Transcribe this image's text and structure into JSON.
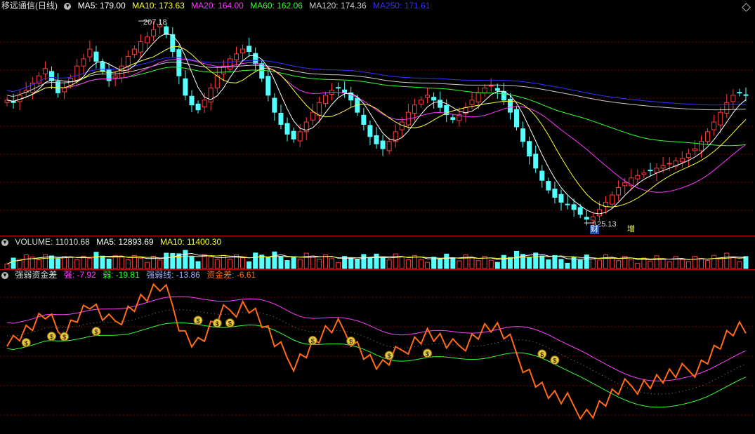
{
  "colors": {
    "up": "#ff3b3b",
    "down": "#54ffff",
    "ma5": "#ffffff",
    "ma10": "#ffff33",
    "ma20": "#ff33ff",
    "ma60": "#33ff33",
    "ma120": "#cccccc",
    "ma250": "#3333ff",
    "strong": "#ff40ff",
    "weak": "#33ff33",
    "diff": "#ff6a1a",
    "grid": "#880000"
  },
  "main": {
    "title": "移远通信(日线)",
    "ma5": "MA5: 179.00",
    "ma10": "MA10: 173.63",
    "ma20": "MA20: 164.00",
    "ma60": "MA60: 162.06",
    "ma120": "MA120: 174.36",
    "ma250": "MA250: 171.61",
    "high_label": "207.18",
    "low_label": "125.13",
    "mark_cai": "财",
    "mark_zeng": "增"
  },
  "volume": {
    "title": "VOLUME: 11010.68",
    "ma5": "MA5: 12893.69",
    "ma10": "MA10: 11400.30"
  },
  "indicator": {
    "title": "强弱资金差",
    "strong": "强: -7.92",
    "weak": "弱: -19.81",
    "line": "强弱线: -13.86",
    "diff": "资金差: -6.61",
    "coin_icon": "money-bag-icon"
  },
  "chart_data": {
    "type": "candlestick",
    "high": 207.18,
    "low": 125.13,
    "closes": [
      176,
      175,
      178,
      180,
      183,
      186,
      189,
      184,
      179,
      181,
      185,
      190,
      193,
      197,
      192,
      188,
      184,
      186,
      190,
      194,
      197,
      200,
      202,
      205,
      207,
      203,
      196,
      186,
      178,
      174,
      172,
      176,
      181,
      186,
      190,
      193,
      195,
      197,
      196,
      191,
      185,
      178,
      171,
      166,
      162,
      160,
      163,
      167,
      171,
      175,
      178,
      180,
      181,
      179,
      176,
      171,
      166,
      161,
      158,
      156,
      159,
      163,
      167,
      171,
      174,
      176,
      178,
      176,
      173,
      170,
      168,
      170,
      173,
      176,
      179,
      181,
      182,
      180,
      176,
      171,
      165,
      159,
      153,
      148,
      143,
      139,
      136,
      134,
      133,
      131,
      129,
      127,
      128,
      131,
      134,
      137,
      140,
      142,
      144,
      145,
      146,
      147,
      148,
      149,
      150,
      151,
      152,
      154,
      156,
      159,
      163,
      167,
      171,
      175,
      178,
      179,
      178
    ],
    "volume_ma5": 12893.69,
    "volume_ma10": 11400.3
  }
}
